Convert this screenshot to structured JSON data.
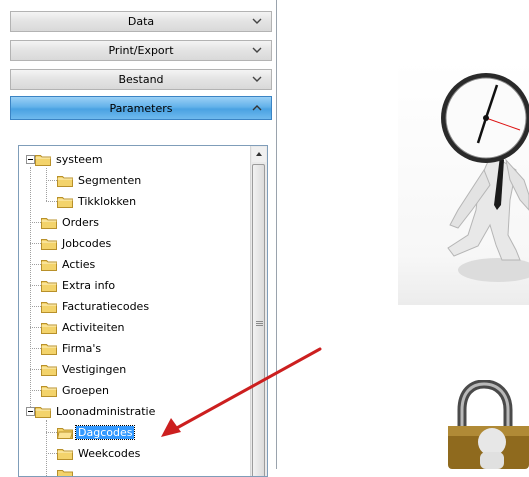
{
  "accordion": [
    {
      "label": "Data",
      "expanded": false
    },
    {
      "label": "Print/Export",
      "expanded": false
    },
    {
      "label": "Bestand",
      "expanded": false
    },
    {
      "label": "Parameters",
      "expanded": true
    }
  ],
  "tree": {
    "systeem": "systeem",
    "segmenten": "Segmenten",
    "tikklokken": "Tikklokken",
    "orders": "Orders",
    "jobcodes": "Jobcodes",
    "acties": "Acties",
    "extra_info": "Extra info",
    "facturatiecodes": "Facturatiecodes",
    "activiteiten": "Activiteiten",
    "firmas": "Firma's",
    "vestigingen": "Vestigingen",
    "groepen": "Groepen",
    "loonadministratie": "Loonadministratie",
    "dagcodes": "Dagcodes",
    "weekcodes": "Weekcodes"
  },
  "selected_item": "Dagcodes",
  "icons": {
    "folder": "folder-icon",
    "chevron_down": "chevron-down-icon",
    "chevron_up": "chevron-up-icon",
    "arrow": "red-arrow-annotation"
  },
  "colors": {
    "accent_blue": "#4aa2e2",
    "selection": "#3399ff",
    "arrow_red": "#cc1f1f",
    "folder_yellow": "#f3d36b"
  }
}
